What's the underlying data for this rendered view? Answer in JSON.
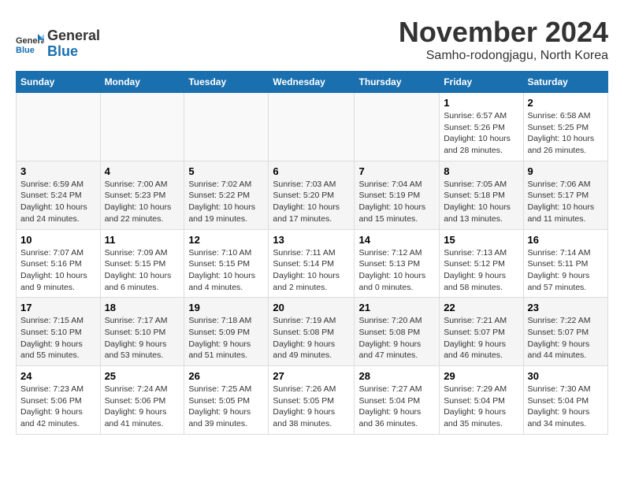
{
  "logo": {
    "general": "General",
    "blue": "Blue"
  },
  "header": {
    "month": "November 2024",
    "location": "Samho-rodongjagu, North Korea"
  },
  "weekdays": [
    "Sunday",
    "Monday",
    "Tuesday",
    "Wednesday",
    "Thursday",
    "Friday",
    "Saturday"
  ],
  "weeks": [
    [
      {
        "day": "",
        "info": ""
      },
      {
        "day": "",
        "info": ""
      },
      {
        "day": "",
        "info": ""
      },
      {
        "day": "",
        "info": ""
      },
      {
        "day": "",
        "info": ""
      },
      {
        "day": "1",
        "info": "Sunrise: 6:57 AM\nSunset: 5:26 PM\nDaylight: 10 hours and 28 minutes."
      },
      {
        "day": "2",
        "info": "Sunrise: 6:58 AM\nSunset: 5:25 PM\nDaylight: 10 hours and 26 minutes."
      }
    ],
    [
      {
        "day": "3",
        "info": "Sunrise: 6:59 AM\nSunset: 5:24 PM\nDaylight: 10 hours and 24 minutes."
      },
      {
        "day": "4",
        "info": "Sunrise: 7:00 AM\nSunset: 5:23 PM\nDaylight: 10 hours and 22 minutes."
      },
      {
        "day": "5",
        "info": "Sunrise: 7:02 AM\nSunset: 5:22 PM\nDaylight: 10 hours and 19 minutes."
      },
      {
        "day": "6",
        "info": "Sunrise: 7:03 AM\nSunset: 5:20 PM\nDaylight: 10 hours and 17 minutes."
      },
      {
        "day": "7",
        "info": "Sunrise: 7:04 AM\nSunset: 5:19 PM\nDaylight: 10 hours and 15 minutes."
      },
      {
        "day": "8",
        "info": "Sunrise: 7:05 AM\nSunset: 5:18 PM\nDaylight: 10 hours and 13 minutes."
      },
      {
        "day": "9",
        "info": "Sunrise: 7:06 AM\nSunset: 5:17 PM\nDaylight: 10 hours and 11 minutes."
      }
    ],
    [
      {
        "day": "10",
        "info": "Sunrise: 7:07 AM\nSunset: 5:16 PM\nDaylight: 10 hours and 9 minutes."
      },
      {
        "day": "11",
        "info": "Sunrise: 7:09 AM\nSunset: 5:15 PM\nDaylight: 10 hours and 6 minutes."
      },
      {
        "day": "12",
        "info": "Sunrise: 7:10 AM\nSunset: 5:15 PM\nDaylight: 10 hours and 4 minutes."
      },
      {
        "day": "13",
        "info": "Sunrise: 7:11 AM\nSunset: 5:14 PM\nDaylight: 10 hours and 2 minutes."
      },
      {
        "day": "14",
        "info": "Sunrise: 7:12 AM\nSunset: 5:13 PM\nDaylight: 10 hours and 0 minutes."
      },
      {
        "day": "15",
        "info": "Sunrise: 7:13 AM\nSunset: 5:12 PM\nDaylight: 9 hours and 58 minutes."
      },
      {
        "day": "16",
        "info": "Sunrise: 7:14 AM\nSunset: 5:11 PM\nDaylight: 9 hours and 57 minutes."
      }
    ],
    [
      {
        "day": "17",
        "info": "Sunrise: 7:15 AM\nSunset: 5:10 PM\nDaylight: 9 hours and 55 minutes."
      },
      {
        "day": "18",
        "info": "Sunrise: 7:17 AM\nSunset: 5:10 PM\nDaylight: 9 hours and 53 minutes."
      },
      {
        "day": "19",
        "info": "Sunrise: 7:18 AM\nSunset: 5:09 PM\nDaylight: 9 hours and 51 minutes."
      },
      {
        "day": "20",
        "info": "Sunrise: 7:19 AM\nSunset: 5:08 PM\nDaylight: 9 hours and 49 minutes."
      },
      {
        "day": "21",
        "info": "Sunrise: 7:20 AM\nSunset: 5:08 PM\nDaylight: 9 hours and 47 minutes."
      },
      {
        "day": "22",
        "info": "Sunrise: 7:21 AM\nSunset: 5:07 PM\nDaylight: 9 hours and 46 minutes."
      },
      {
        "day": "23",
        "info": "Sunrise: 7:22 AM\nSunset: 5:07 PM\nDaylight: 9 hours and 44 minutes."
      }
    ],
    [
      {
        "day": "24",
        "info": "Sunrise: 7:23 AM\nSunset: 5:06 PM\nDaylight: 9 hours and 42 minutes."
      },
      {
        "day": "25",
        "info": "Sunrise: 7:24 AM\nSunset: 5:06 PM\nDaylight: 9 hours and 41 minutes."
      },
      {
        "day": "26",
        "info": "Sunrise: 7:25 AM\nSunset: 5:05 PM\nDaylight: 9 hours and 39 minutes."
      },
      {
        "day": "27",
        "info": "Sunrise: 7:26 AM\nSunset: 5:05 PM\nDaylight: 9 hours and 38 minutes."
      },
      {
        "day": "28",
        "info": "Sunrise: 7:27 AM\nSunset: 5:04 PM\nDaylight: 9 hours and 36 minutes."
      },
      {
        "day": "29",
        "info": "Sunrise: 7:29 AM\nSunset: 5:04 PM\nDaylight: 9 hours and 35 minutes."
      },
      {
        "day": "30",
        "info": "Sunrise: 7:30 AM\nSunset: 5:04 PM\nDaylight: 9 hours and 34 minutes."
      }
    ]
  ]
}
